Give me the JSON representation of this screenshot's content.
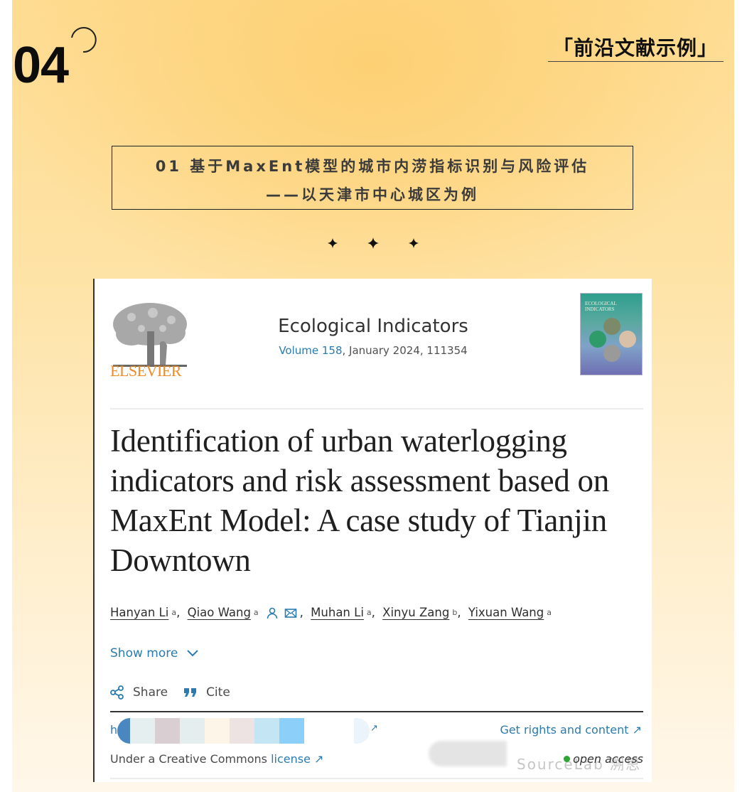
{
  "header": {
    "section_number": "04",
    "corner_title": "「前沿文献示例」"
  },
  "paper_heading": {
    "line1": "01 基于MaxEnt模型的城市内涝指标识别与风险评估",
    "line2": "——以天津市中心城区为例"
  },
  "decoration": {
    "stars": [
      "star-icon",
      "star-icon",
      "star-icon"
    ]
  },
  "article_card": {
    "publisher_logo_text": "ELSEVIER",
    "journal_name": "Ecological Indicators",
    "volume_label": "Volume 158",
    "issue_info": ", January 2024, 111354",
    "cover_title": "ECOLOGICAL INDICATORS",
    "title": "Identification of urban waterlogging indicators and risk assessment based on MaxEnt Model: A case study of Tianjin Downtown",
    "authors": [
      {
        "name": "Hanyan Li",
        "affiliation": "a"
      },
      {
        "name": "Qiao Wang",
        "affiliation": "a",
        "icons": [
          "person-icon",
          "envelope-icon"
        ]
      },
      {
        "name": "Muhan Li",
        "affiliation": "a"
      },
      {
        "name": "Xinyu Zang",
        "affiliation": "b"
      },
      {
        "name": "Yixuan Wang",
        "affiliation": "a"
      }
    ],
    "show_more_label": "Show more",
    "share_label": "Share",
    "cite_label": "Cite",
    "doi_prefix": "h",
    "doi_suffix_icon": "↗",
    "rights_label": "Get rights and content ↗",
    "license_prefix": "Under a Creative Commons ",
    "license_link": "license ↗",
    "open_access_label": "open access",
    "watermark_text": "SourceLab 溯思"
  },
  "colors": {
    "link_blue": "#2a7bb0",
    "elsevier_orange": "#f08a24",
    "open_access_green": "#2fa535",
    "background_gold": "#fdd074"
  }
}
